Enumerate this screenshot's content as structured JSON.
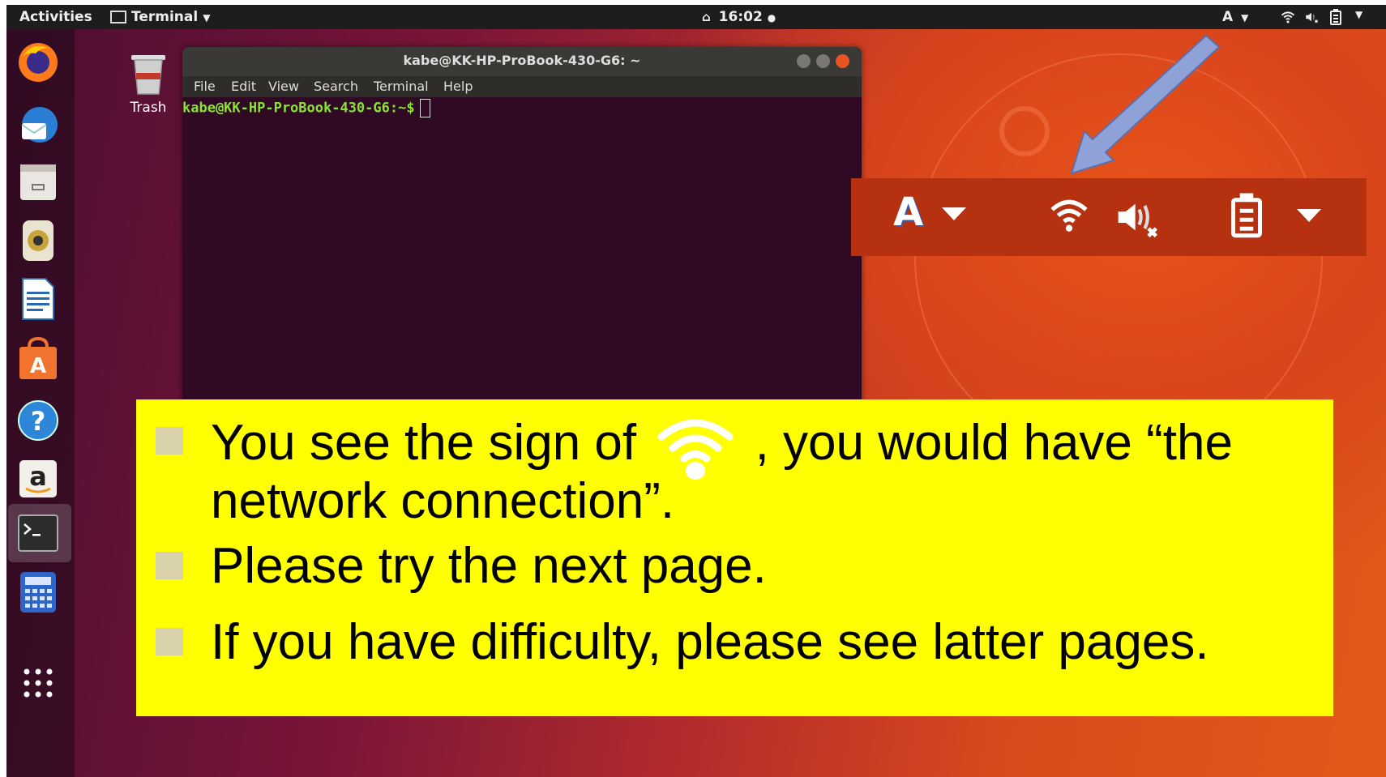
{
  "topbar": {
    "activities": "Activities",
    "app_menu": "Terminal",
    "clock": "16:02",
    "input_indicator": "A"
  },
  "desktop": {
    "trash_label": "Trash"
  },
  "terminal": {
    "title": "kabe@KK-HP-ProBook-430-G6: ~",
    "menu": [
      "File",
      "Edit",
      "View",
      "Search",
      "Terminal",
      "Help"
    ],
    "prompt": "kabe@KK-HP-ProBook-430-G6:~$"
  },
  "zoom_panel": {
    "input_indicator": "A"
  },
  "callout": {
    "line1_a": "You see the sign of",
    "line1_b": ",  you would have “the",
    "line1_c": "network connection”.",
    "line2": "Please try the next page.",
    "line3": "If you have difficulty, please see latter pages."
  },
  "colors": {
    "topbar": "#1d1d1d",
    "terminal_bg": "#300a24",
    "prompt_green": "#8ae234",
    "zoom_panel": "#b5310f",
    "callout_bg": "#ffff00",
    "arrow": "#8ea2d8"
  },
  "icons": [
    "firefox-icon",
    "thunderbird-icon",
    "files-icon",
    "rhythmbox-icon",
    "writer-icon",
    "software-icon",
    "help-icon",
    "amazon-icon",
    "terminal-icon",
    "calculator-icon",
    "show-apps-icon",
    "wifi-icon",
    "volume-muted-icon",
    "battery-icon",
    "chevron-down-icon",
    "trash-icon"
  ]
}
